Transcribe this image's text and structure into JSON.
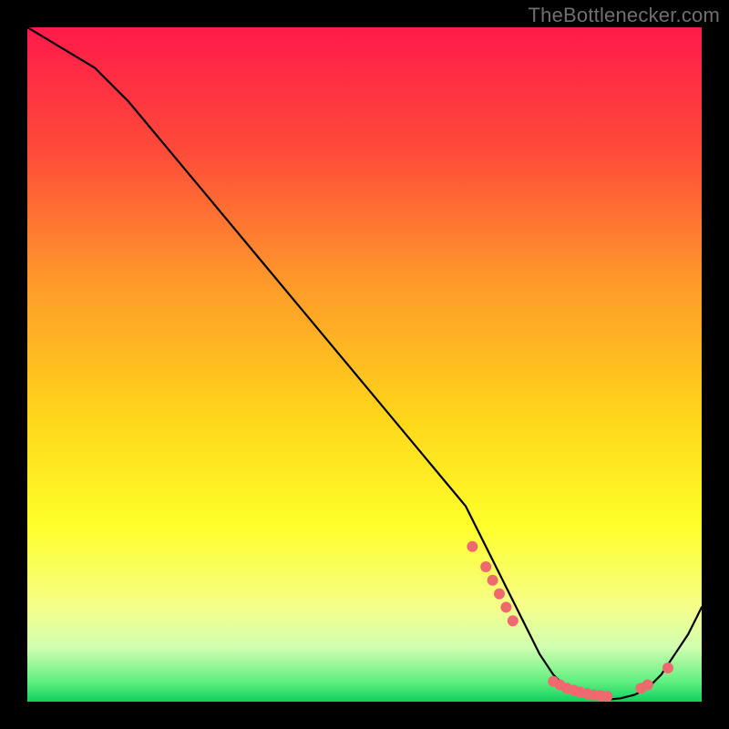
{
  "watermark": "TheBottlenecker.com",
  "chart_data": {
    "type": "line",
    "title": "",
    "xlabel": "",
    "ylabel": "",
    "xlim": [
      0,
      100
    ],
    "ylim": [
      0,
      100
    ],
    "x": [
      0,
      5,
      10,
      15,
      20,
      25,
      30,
      35,
      40,
      45,
      50,
      55,
      60,
      65,
      68,
      70,
      72,
      74,
      76,
      78,
      80,
      82,
      84,
      86,
      88,
      90,
      92,
      94,
      96,
      98,
      100
    ],
    "values": [
      100,
      97,
      94,
      89,
      83,
      77,
      71,
      65,
      59,
      53,
      47,
      41,
      35,
      29,
      23,
      19,
      15,
      11,
      7,
      4,
      2,
      1,
      0.5,
      0.3,
      0.5,
      1,
      2,
      4,
      7,
      10,
      14
    ],
    "highlight_points_x": [
      66,
      68,
      69,
      70,
      71,
      72,
      78,
      79,
      80,
      81,
      82,
      83,
      84,
      85,
      86,
      91,
      92,
      95
    ],
    "highlight_points_y": [
      23,
      20,
      18,
      16,
      14,
      12,
      3,
      2.5,
      2,
      1.7,
      1.4,
      1.2,
      1,
      0.9,
      0.8,
      2,
      2.5,
      5
    ],
    "gradient_stops": [
      {
        "pos": 0.0,
        "color": "#ff1a4a"
      },
      {
        "pos": 0.18,
        "color": "#ff4a3a"
      },
      {
        "pos": 0.38,
        "color": "#ff9a2a"
      },
      {
        "pos": 0.58,
        "color": "#ffd61a"
      },
      {
        "pos": 0.74,
        "color": "#ffff2a"
      },
      {
        "pos": 0.86,
        "color": "#f5ff8a"
      },
      {
        "pos": 0.92,
        "color": "#d0ffb0"
      },
      {
        "pos": 0.97,
        "color": "#60f080"
      },
      {
        "pos": 1.0,
        "color": "#10d060"
      }
    ],
    "marker_color": "#ef6a6e"
  }
}
